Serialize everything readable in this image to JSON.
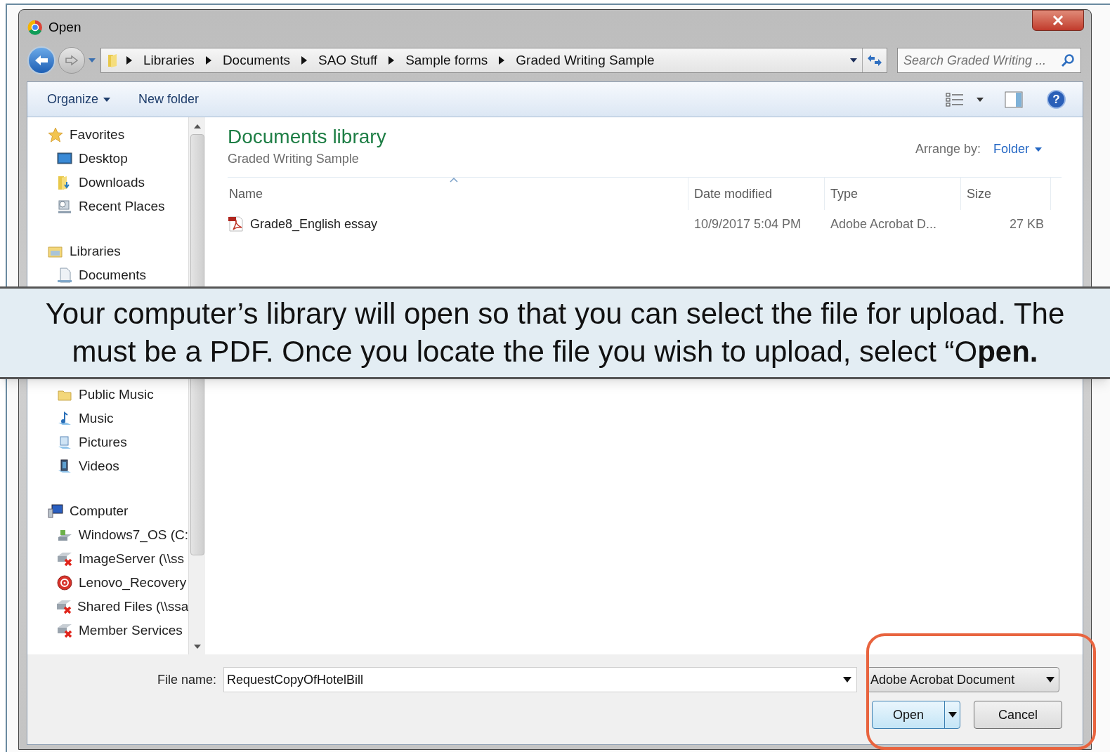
{
  "window": {
    "title": "Open"
  },
  "address_bar": {
    "breadcrumbs": [
      "Libraries",
      "Documents",
      "SAO Stuff",
      "Sample forms",
      "Graded Writing Sample"
    ]
  },
  "search": {
    "placeholder": "Search Graded Writing ..."
  },
  "toolbar": {
    "buttons": [
      {
        "label": "Organize",
        "dropdown": true
      },
      {
        "label": "New folder",
        "dropdown": false
      }
    ],
    "help_label": "?"
  },
  "sidebar": {
    "groups": [
      {
        "label": "Favorites",
        "kind": "star",
        "children": [
          {
            "label": "Desktop",
            "kind": "desktop"
          },
          {
            "label": "Downloads",
            "kind": "download-folder"
          },
          {
            "label": "Recent Places",
            "kind": "recent"
          }
        ]
      },
      {
        "label": "Libraries",
        "kind": "library",
        "children": [
          {
            "label": "Documents",
            "kind": "document"
          },
          {
            "label": "Public Music",
            "kind": "folder"
          },
          {
            "label": "Music",
            "kind": "music"
          },
          {
            "label": "Pictures",
            "kind": "pictures"
          },
          {
            "label": "Videos",
            "kind": "videos"
          }
        ]
      },
      {
        "label": "Computer",
        "kind": "computer",
        "children": [
          {
            "label": "Windows7_OS (C:",
            "kind": "drive"
          },
          {
            "label": "ImageServer (\\\\ss",
            "kind": "network-drive"
          },
          {
            "label": "Lenovo_Recovery",
            "kind": "recovery"
          },
          {
            "label": "Shared Files (\\\\ssa",
            "kind": "network-drive"
          },
          {
            "label": "Member Services",
            "kind": "network-drive"
          }
        ]
      }
    ]
  },
  "library": {
    "title": "Documents library",
    "subtitle": "Graded Writing Sample",
    "arrange_label": "Arrange by:",
    "arrange_value": "Folder"
  },
  "table": {
    "columns": [
      {
        "label": "Name",
        "sorted": true
      },
      {
        "label": "Date modified",
        "sorted": false
      },
      {
        "label": "Type",
        "sorted": false
      },
      {
        "label": "Size",
        "sorted": false
      }
    ],
    "rows": [
      {
        "name": "Grade8_English essay",
        "date": "10/9/2017 5:04 PM",
        "type": "Adobe Acrobat D...",
        "size": "27 KB"
      }
    ]
  },
  "footer": {
    "file_name_label": "File name:",
    "file_name": "RequestCopyOfHotelBill",
    "file_type": "Adobe Acrobat Document",
    "open_button": "Open",
    "cancel_button": "Cancel"
  },
  "caption": {
    "lines": [
      "Your computer’s library will open so that you can select the file for upload. The",
      "must be a PDF. Once you locate the file you wish to upload, select “O**pen.**"
    ]
  }
}
